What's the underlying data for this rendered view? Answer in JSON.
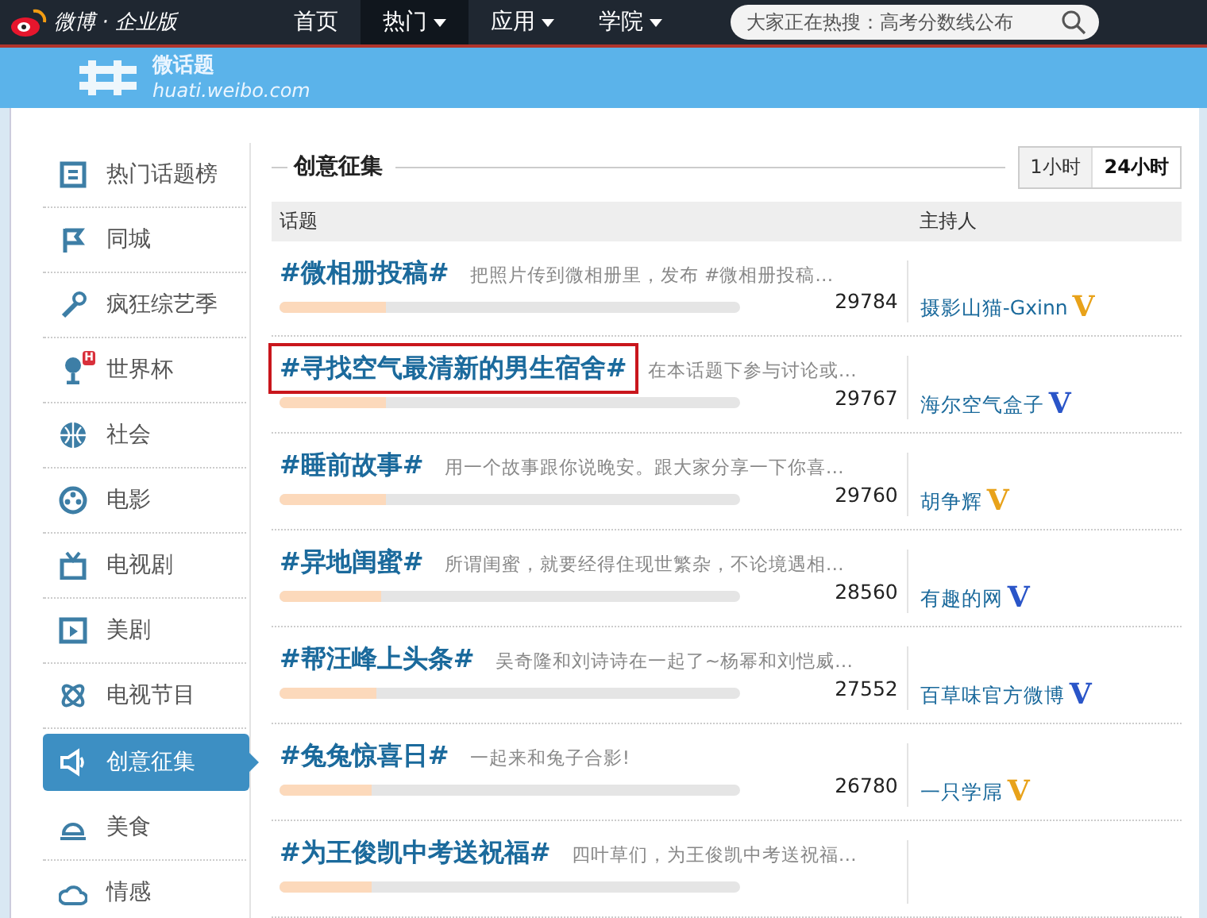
{
  "top_nav": {
    "brand": "微博 · 企业版",
    "items": [
      {
        "label": "首页",
        "selected": false,
        "dropdown": false
      },
      {
        "label": "热门",
        "selected": true,
        "dropdown": true
      },
      {
        "label": "应用",
        "selected": false,
        "dropdown": true
      },
      {
        "label": "学院",
        "selected": false,
        "dropdown": true
      }
    ],
    "search": {
      "placeholder": "大家正在热搜：高考分数线公布"
    }
  },
  "banner": {
    "logo": "微话题",
    "url": "huati.weibo.com"
  },
  "sidebar": {
    "items": [
      {
        "label": "热门话题榜",
        "selected": false
      },
      {
        "label": "同城",
        "selected": false
      },
      {
        "label": "疯狂综艺季",
        "selected": false
      },
      {
        "label": "世界杯",
        "selected": false,
        "badge": "H"
      },
      {
        "label": "社会",
        "selected": false
      },
      {
        "label": "电影",
        "selected": false
      },
      {
        "label": "电视剧",
        "selected": false
      },
      {
        "label": "美剧",
        "selected": false
      },
      {
        "label": "电视节目",
        "selected": false
      },
      {
        "label": "创意征集",
        "selected": true
      },
      {
        "label": "美食",
        "selected": false
      },
      {
        "label": "情感",
        "selected": false
      }
    ]
  },
  "content": {
    "title": "创意征集",
    "range_tabs": [
      {
        "label": "1小时",
        "selected": false
      },
      {
        "label": "24小时",
        "selected": true
      }
    ],
    "table": {
      "columns": [
        "话题",
        "主持人"
      ],
      "rows": [
        {
          "topic": "#微相册投稿#",
          "desc": "把照片传到微相册里，发布 #微相册投稿…",
          "level": 0.23,
          "count": "29784",
          "host": "摄影山猫-Gxinn",
          "badge": {
            "text": "V",
            "color": "#e8a21a"
          },
          "highlighted": false
        },
        {
          "topic": "#寻找空气最清新的男生宿舍#",
          "desc": "在本话题下参与讨论或…",
          "level": 0.23,
          "count": "29767",
          "host": "海尔空气盒子",
          "badge": {
            "text": "V",
            "color": "#2a55c8"
          },
          "highlighted": true
        },
        {
          "topic": "#睡前故事#",
          "desc": "用一个故事跟你说晚安。跟大家分享一下你喜…",
          "level": 0.23,
          "count": "29760",
          "host": "胡争辉",
          "badge": {
            "text": "V",
            "color": "#e8a21a"
          },
          "highlighted": false
        },
        {
          "topic": "#异地闺蜜#",
          "desc": "所谓闺蜜，就要经得住现世繁杂，不论境遇相…",
          "level": 0.22,
          "count": "28560",
          "host": "有趣的网",
          "badge": {
            "text": "V",
            "color": "#2a55c8"
          },
          "highlighted": false
        },
        {
          "topic": "#帮汪峰上头条#",
          "desc": "吴奇隆和刘诗诗在一起了~杨幂和刘恺威…",
          "level": 0.21,
          "count": "27552",
          "host": "百草味官方微博",
          "badge": {
            "text": "V",
            "color": "#2a55c8"
          },
          "highlighted": false
        },
        {
          "topic": "#兔兔惊喜日#",
          "desc": "一起来和兔子合影!",
          "level": 0.2,
          "count": "26780",
          "host": "一只学屌",
          "badge": {
            "text": "V",
            "color": "#e8a21a"
          },
          "highlighted": false
        },
        {
          "topic": "#为王俊凯中考送祝福#",
          "desc": "四叶草们，为王俊凯中考送祝福…",
          "level": 0.2,
          "highlighted": false
        }
      ]
    }
  }
}
